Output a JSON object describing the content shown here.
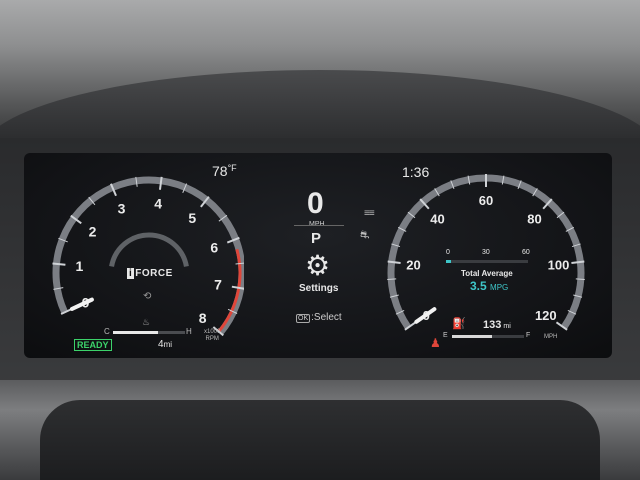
{
  "header": {
    "outside_temp": "78",
    "temp_unit": "°F",
    "clock": "1:36"
  },
  "tachometer": {
    "ticks": [
      "0",
      "1",
      "2",
      "3",
      "4",
      "5",
      "6",
      "7",
      "8"
    ],
    "rpm_value": 0,
    "unit_line1": "x1000",
    "unit_line2": "RPM",
    "brand": "FORCE",
    "brand_prefix": "i",
    "ready": "READY",
    "coolant_low": "C",
    "coolant_high": "H",
    "trip": "4",
    "trip_unit": "mi",
    "redline_color": "#e0463a"
  },
  "center": {
    "speed": "0",
    "speed_unit": "MPH",
    "gear": "P",
    "menu_label": "Settings",
    "ok_key": "OK",
    "hint": ":Select"
  },
  "speedometer": {
    "ticks": [
      "0",
      "20",
      "40",
      "60",
      "80",
      "100",
      "120"
    ],
    "speed_value": 0,
    "unit": "MPH",
    "mini_scale": [
      "0",
      "30",
      "60"
    ],
    "avg_label": "Total Average",
    "avg_value": "3.5",
    "avg_unit": "MPG",
    "range": "133",
    "range_unit": "mi",
    "fuel_empty": "E",
    "fuel_full": "F",
    "fuel_level": 0.55,
    "accent_color": "#3ec6c9"
  }
}
